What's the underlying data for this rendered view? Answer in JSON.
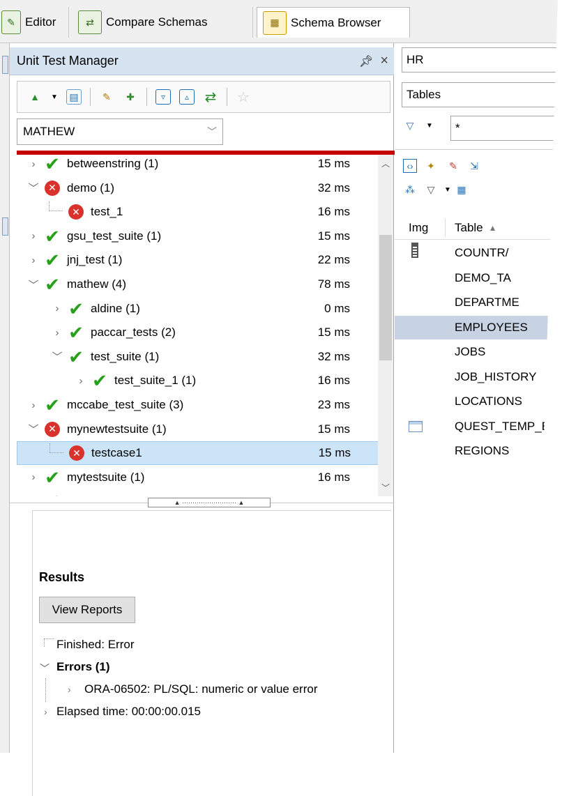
{
  "tabs": [
    {
      "label": "Editor"
    },
    {
      "label": "Compare Schemas"
    },
    {
      "label": "Schema Browser"
    }
  ],
  "unit_test_manager": {
    "title": "Unit Test Manager",
    "pin_glyph": "†",
    "close_glyph": "×",
    "schema_value": "MATHEW",
    "tree": [
      {
        "label": "betweenstring  (1)",
        "time": "15 ms",
        "status": "ok",
        "level": 0,
        "expander": "collapsed"
      },
      {
        "label": "demo  (1)",
        "time": "32 ms",
        "status": "error",
        "level": 0,
        "expander": "expanded"
      },
      {
        "label": "test_1",
        "time": "16 ms",
        "status": "error",
        "level": 1,
        "expander": "none"
      },
      {
        "label": "gsu_test_suite  (1)",
        "time": "15 ms",
        "status": "ok",
        "level": 0,
        "expander": "collapsed"
      },
      {
        "label": "jnj_test  (1)",
        "time": "22 ms",
        "status": "ok",
        "level": 0,
        "expander": "collapsed"
      },
      {
        "label": "mathew  (4)",
        "time": "78 ms",
        "status": "ok",
        "level": 0,
        "expander": "expanded"
      },
      {
        "label": "aldine  (1)",
        "time": "0 ms",
        "status": "ok",
        "level": 1,
        "expander": "collapsed"
      },
      {
        "label": "paccar_tests  (2)",
        "time": "15 ms",
        "status": "ok",
        "level": 1,
        "expander": "collapsed"
      },
      {
        "label": "test_suite  (1)",
        "time": "32 ms",
        "status": "ok",
        "level": 1,
        "expander": "expanded"
      },
      {
        "label": "test_suite_1  (1)",
        "time": "16 ms",
        "status": "ok",
        "level": 2,
        "expander": "collapsed"
      },
      {
        "label": "mccabe_test_suite  (3)",
        "time": "23 ms",
        "status": "ok",
        "level": 0,
        "expander": "collapsed"
      },
      {
        "label": "mynewtestsuite  (1)",
        "time": "15 ms",
        "status": "error",
        "level": 0,
        "expander": "expanded"
      },
      {
        "label": "testcase1",
        "time": "15 ms",
        "status": "error",
        "level": 1,
        "expander": "none",
        "selected": true
      },
      {
        "label": "mytestsuite  (1)",
        "time": "16 ms",
        "status": "ok",
        "level": 0,
        "expander": "collapsed"
      }
    ]
  },
  "results": {
    "title": "Results",
    "view_reports": "View Reports",
    "finished": "Finished: Error",
    "errors": "Errors  (1)",
    "error_detail": "ORA-06502: PL/SQL: numeric or value error",
    "elapsed": "Elapsed time: 00:00:00.015"
  },
  "schema_browser": {
    "schema": "HR",
    "object_type": "Tables",
    "filter": "*",
    "col_img": "Img",
    "col_table": "Table",
    "tables": [
      "COUNTR/",
      "DEMO_TA",
      "DEPARTME",
      "EMPLOYEES",
      "JOBS",
      "JOB_HISTORY",
      "LOCATIONS",
      "QUEST_TEMP_EX",
      "REGIONS"
    ],
    "selected_table": "EMPLOYEES"
  },
  "colors": {
    "ok": "#27a019",
    "error": "#d9322c",
    "selection": "#cce4f7",
    "header": "#d6e3f0",
    "redbar": "#c40000"
  }
}
